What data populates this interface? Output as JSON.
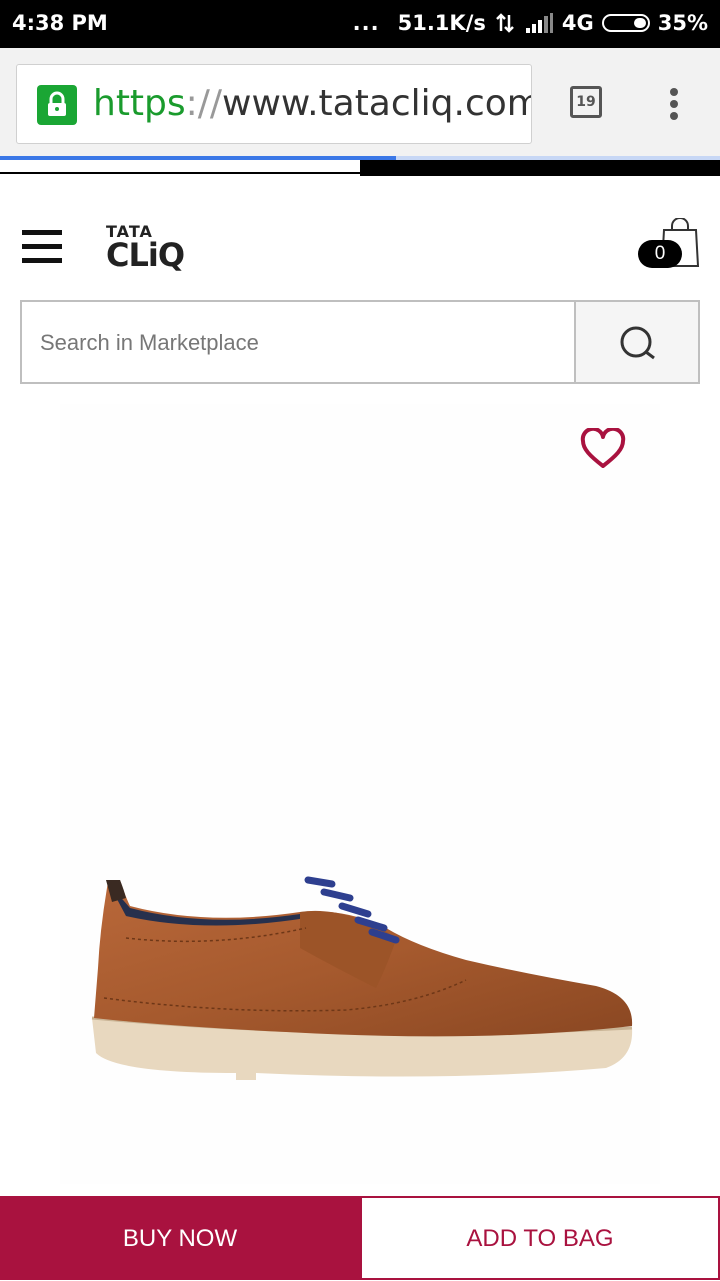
{
  "status_bar": {
    "time": "4:38 PM",
    "dots": "...",
    "network_speed": "51.1K/s",
    "network_type": "4G",
    "battery": "35%"
  },
  "browser": {
    "url_protocol": "https",
    "url_separator": "://",
    "url_rest": "www.tatacliq.com/id",
    "tab_count": "19",
    "page_load_progress_percent": 55,
    "secure_color": "#1aa634",
    "progress_color": "#3b78e7"
  },
  "header": {
    "logo_top": "TATA",
    "logo_bottom": "CLiQ",
    "cart_count": "0",
    "icons": [
      "hamburger-menu-icon",
      "shopping-bag-icon"
    ]
  },
  "search": {
    "placeholder": "Search in Marketplace",
    "value": "",
    "icon": "search-icon"
  },
  "product": {
    "wishlist_icon": "heart-icon",
    "image": "brown-leather-derby-shoe"
  },
  "actions": {
    "buy_now": "BUY NOW",
    "add_to_bag": "ADD TO BAG",
    "accent_color": "#a9123f"
  }
}
